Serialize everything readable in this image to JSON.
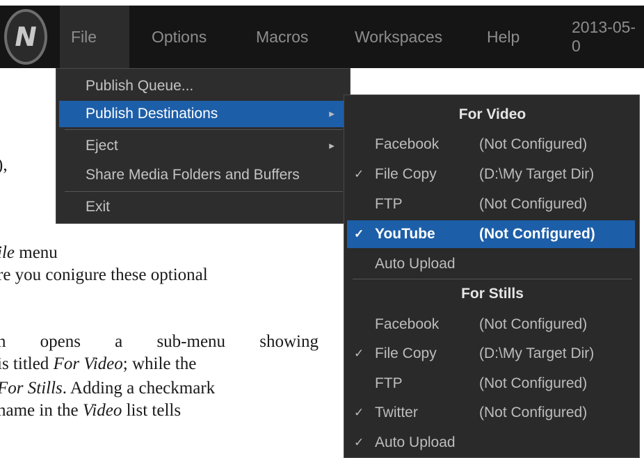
{
  "menubar": {
    "items": [
      "File",
      "Options",
      "Macros",
      "Workspaces",
      "Help",
      "2013-05-0"
    ]
  },
  "file_menu": {
    "items": [
      "Publish Queue...",
      "Publish Destinations",
      "Eject",
      "Share Media Folders and Buffers",
      "Exit"
    ],
    "submenu_arrow": "▶"
  },
  "submenu": {
    "video_header": "For Video",
    "video_rows": [
      {
        "check": "",
        "name": "Facebook",
        "status": "(Not Configured)"
      },
      {
        "check": "✓",
        "name": "File Copy",
        "status": "(D:\\My Target Dir)"
      },
      {
        "check": "",
        "name": "FTP",
        "status": "(Not Configured)"
      },
      {
        "check": "✓",
        "name": "YouTube",
        "status": "(Not Configured)"
      },
      {
        "check": "",
        "name": "Auto Upload",
        "status": ""
      }
    ],
    "stills_header": "For Stills",
    "stills_rows": [
      {
        "check": "",
        "name": "Facebook",
        "status": "(Not Configured)"
      },
      {
        "check": "✓",
        "name": "File Copy",
        "status": "(D:\\My Target Dir)"
      },
      {
        "check": "",
        "name": "FTP",
        "status": "(Not Configured)"
      },
      {
        "check": "✓",
        "name": "Twitter",
        "status": "(Not Configured)"
      },
      {
        "check": "✓",
        "name": "Auto Upload",
        "status": ""
      }
    ]
  },
  "document": {
    "l1": "),",
    "l2a": "ile",
    "l2b": " menu",
    "l3": "re you conigure these optional",
    "l4a": "n",
    "l4b": "opens",
    "l4c": "a",
    "l4d": "sub-menu",
    "l4e": "showing",
    "l5a": "is titled ",
    "l5b": "For Video",
    "l5c": "; while the",
    "l6a": "For Stills",
    "l6b": ". Adding a checkmark",
    "l7a": "name in the ",
    "l7b": "Video",
    "l7c": " list tells"
  },
  "colors": {
    "menubar_bg": "#151515",
    "menu_bg": "#2d2d2d",
    "highlight": "#1d5ea8"
  }
}
